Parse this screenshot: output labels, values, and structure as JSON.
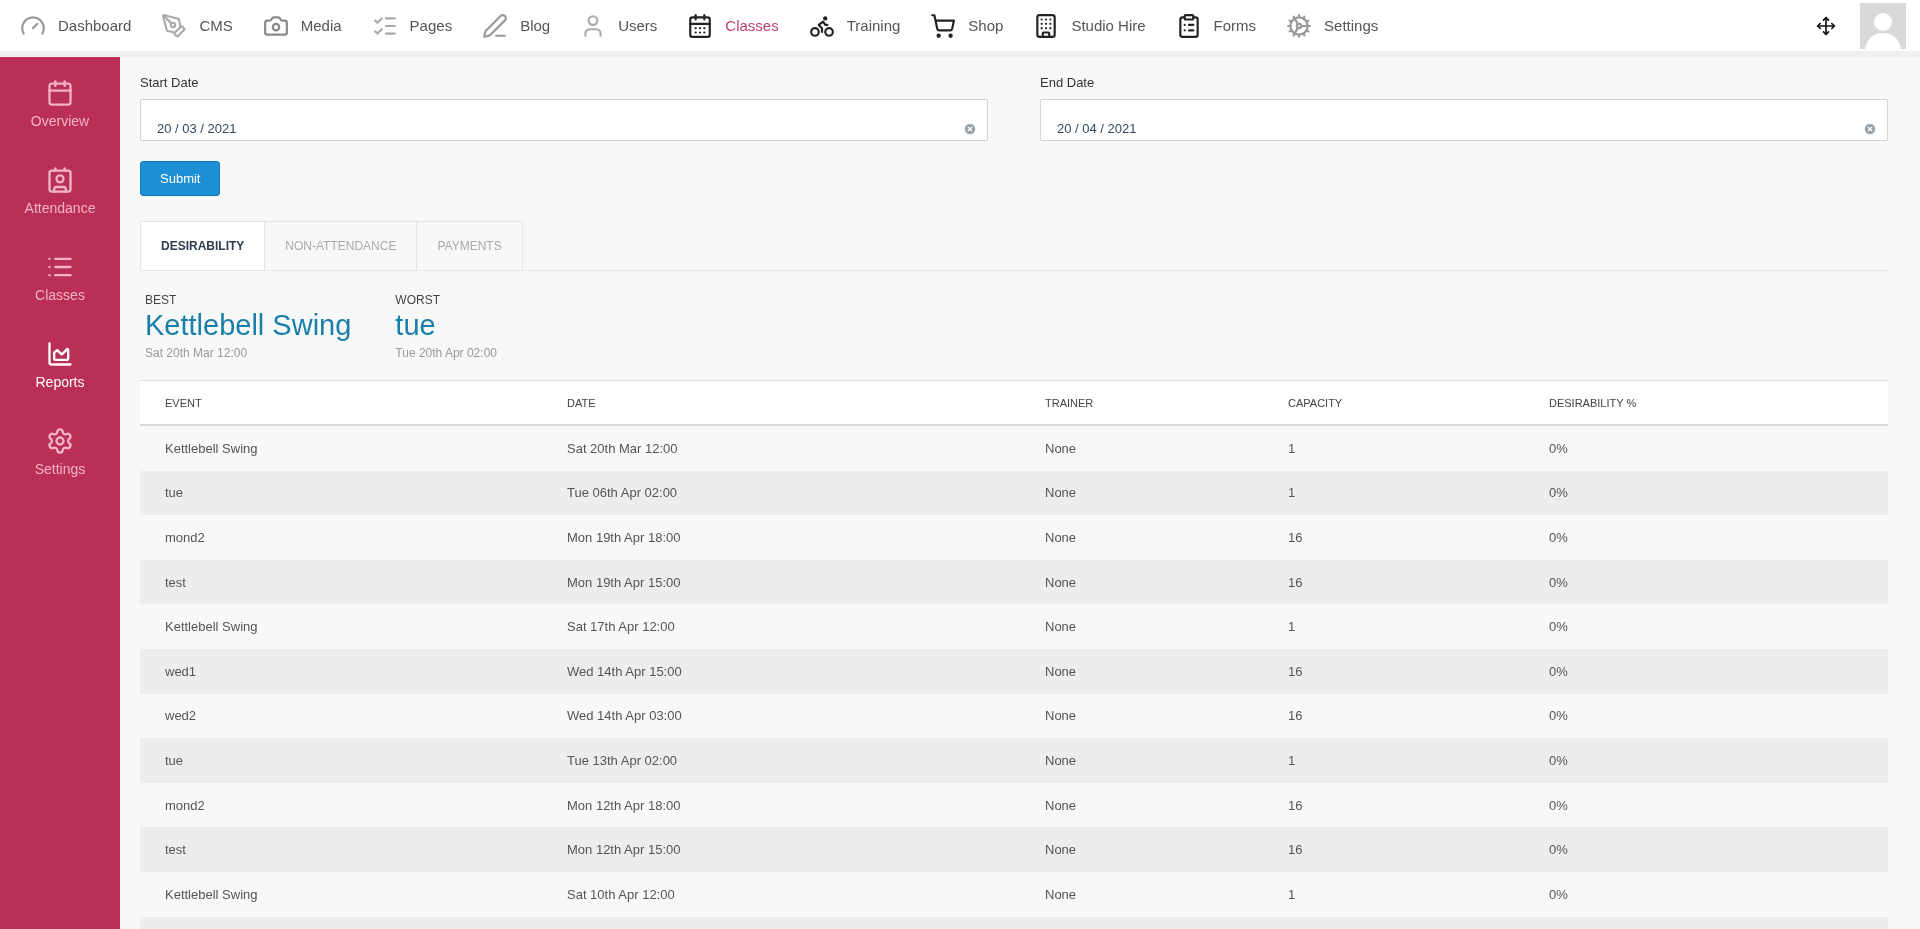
{
  "top_nav": [
    {
      "label": "Dashboard",
      "selected": false
    },
    {
      "label": "CMS",
      "selected": false
    },
    {
      "label": "Media",
      "selected": false
    },
    {
      "label": "Pages",
      "selected": false
    },
    {
      "label": "Blog",
      "selected": false
    },
    {
      "label": "Users",
      "selected": false
    },
    {
      "label": "Classes",
      "selected": true
    },
    {
      "label": "Training",
      "selected": false
    },
    {
      "label": "Shop",
      "selected": false
    },
    {
      "label": "Studio Hire",
      "selected": false
    },
    {
      "label": "Forms",
      "selected": false
    },
    {
      "label": "Settings",
      "selected": false
    }
  ],
  "sidebar": {
    "items": [
      {
        "label": "Overview",
        "selected": false
      },
      {
        "label": "Attendance",
        "selected": false
      },
      {
        "label": "Classes",
        "selected": false
      },
      {
        "label": "Reports",
        "selected": true
      },
      {
        "label": "Settings",
        "selected": false
      }
    ]
  },
  "filters": {
    "start_date": {
      "label": "Start Date",
      "value": "20 / 03 / 2021"
    },
    "end_date": {
      "label": "End Date",
      "value": "20 / 04 / 2021"
    },
    "submit": "Submit"
  },
  "tabs": [
    {
      "label": "DESIRABILITY",
      "selected": true
    },
    {
      "label": "NON-ATTENDANCE",
      "selected": false
    },
    {
      "label": "PAYMENTS",
      "selected": false
    }
  ],
  "summary": [
    {
      "label": "BEST",
      "name": "Kettlebell Swing",
      "date": "Sat 20th Mar 12:00"
    },
    {
      "label": "WORST",
      "name": "tue",
      "date": "Tue 20th Apr 02:00"
    }
  ],
  "table": {
    "columns": [
      "EVENT",
      "DATE",
      "TRAINER",
      "CAPACITY",
      "DESIRABILITY %"
    ],
    "rows": [
      [
        "Kettlebell Swing",
        "Sat 20th Mar 12:00",
        "None",
        "1",
        "0%"
      ],
      [
        "tue",
        "Tue 06th Apr 02:00",
        "None",
        "1",
        "0%"
      ],
      [
        "mond2",
        "Mon 19th Apr 18:00",
        "None",
        "16",
        "0%"
      ],
      [
        "test",
        "Mon 19th Apr 15:00",
        "None",
        "16",
        "0%"
      ],
      [
        "Kettlebell Swing",
        "Sat 17th Apr 12:00",
        "None",
        "1",
        "0%"
      ],
      [
        "wed1",
        "Wed 14th Apr 15:00",
        "None",
        "16",
        "0%"
      ],
      [
        "wed2",
        "Wed 14th Apr 03:00",
        "None",
        "16",
        "0%"
      ],
      [
        "tue",
        "Tue 13th Apr 02:00",
        "None",
        "1",
        "0%"
      ],
      [
        "mond2",
        "Mon 12th Apr 18:00",
        "None",
        "16",
        "0%"
      ],
      [
        "test",
        "Mon 12th Apr 15:00",
        "None",
        "16",
        "0%"
      ],
      [
        "Kettlebell Swing",
        "Sat 10th Apr 12:00",
        "None",
        "1",
        "0%"
      ]
    ]
  }
}
